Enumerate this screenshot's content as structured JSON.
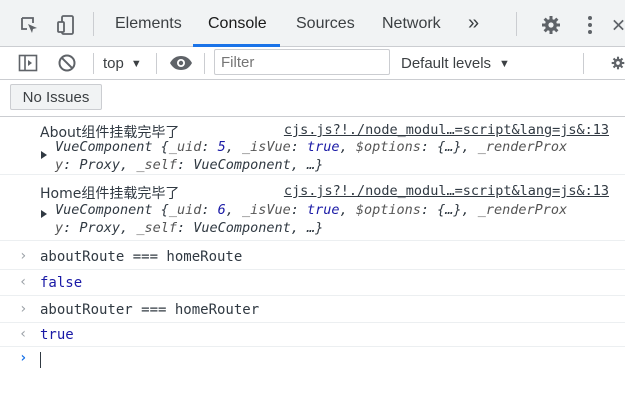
{
  "tabs": [
    {
      "label": "Elements"
    },
    {
      "label": "Console"
    },
    {
      "label": "Sources"
    },
    {
      "label": "Network"
    }
  ],
  "more_tabs_glyph": "»",
  "active_tab": "Console",
  "toolbar": {
    "context": "top",
    "context_arrow": "▼",
    "filter_placeholder": "Filter",
    "levels": "Default levels",
    "levels_arrow": "▼",
    "issues": "No Issues"
  },
  "messages": [
    {
      "text": "About组件挂载完毕了",
      "source": "cjs.js?!./node_modul…=script&lang=js&:13",
      "obj_line1": {
        "name": "VueComponent",
        "uid_key": "_uid",
        "uid_val": "5",
        "isvue_key": "_isVue",
        "isvue_val": "true",
        "opts_key": "$options",
        "opts_val": "{…}",
        "tail": "_renderProx"
      },
      "obj_line2": {
        "head": "y",
        "proxy": "Proxy",
        "self_key": "_self",
        "self_val": "VueComponent",
        "tail": "…}"
      }
    },
    {
      "text": "Home组件挂载完毕了",
      "source": "cjs.js?!./node_modul…=script&lang=js&:13",
      "obj_line1": {
        "name": "VueComponent",
        "uid_key": "_uid",
        "uid_val": "6",
        "isvue_key": "_isVue",
        "isvue_val": "true",
        "opts_key": "$options",
        "opts_val": "{…}",
        "tail": "_renderProx"
      },
      "obj_line2": {
        "head": "y",
        "proxy": "Proxy",
        "self_key": "_self",
        "self_val": "VueComponent",
        "tail": "…}"
      }
    }
  ],
  "evaluations": [
    {
      "input": "aboutRoute === homeRoute",
      "output": "false"
    },
    {
      "input": "aboutRouter === homeRouter",
      "output": "true"
    }
  ],
  "input_prompt": "›",
  "result_prompt": "‹",
  "colors": {
    "accent": "#1a73e8",
    "keyword": "#1a1aa6",
    "text": "#303942",
    "border": "#cbcdd1"
  }
}
